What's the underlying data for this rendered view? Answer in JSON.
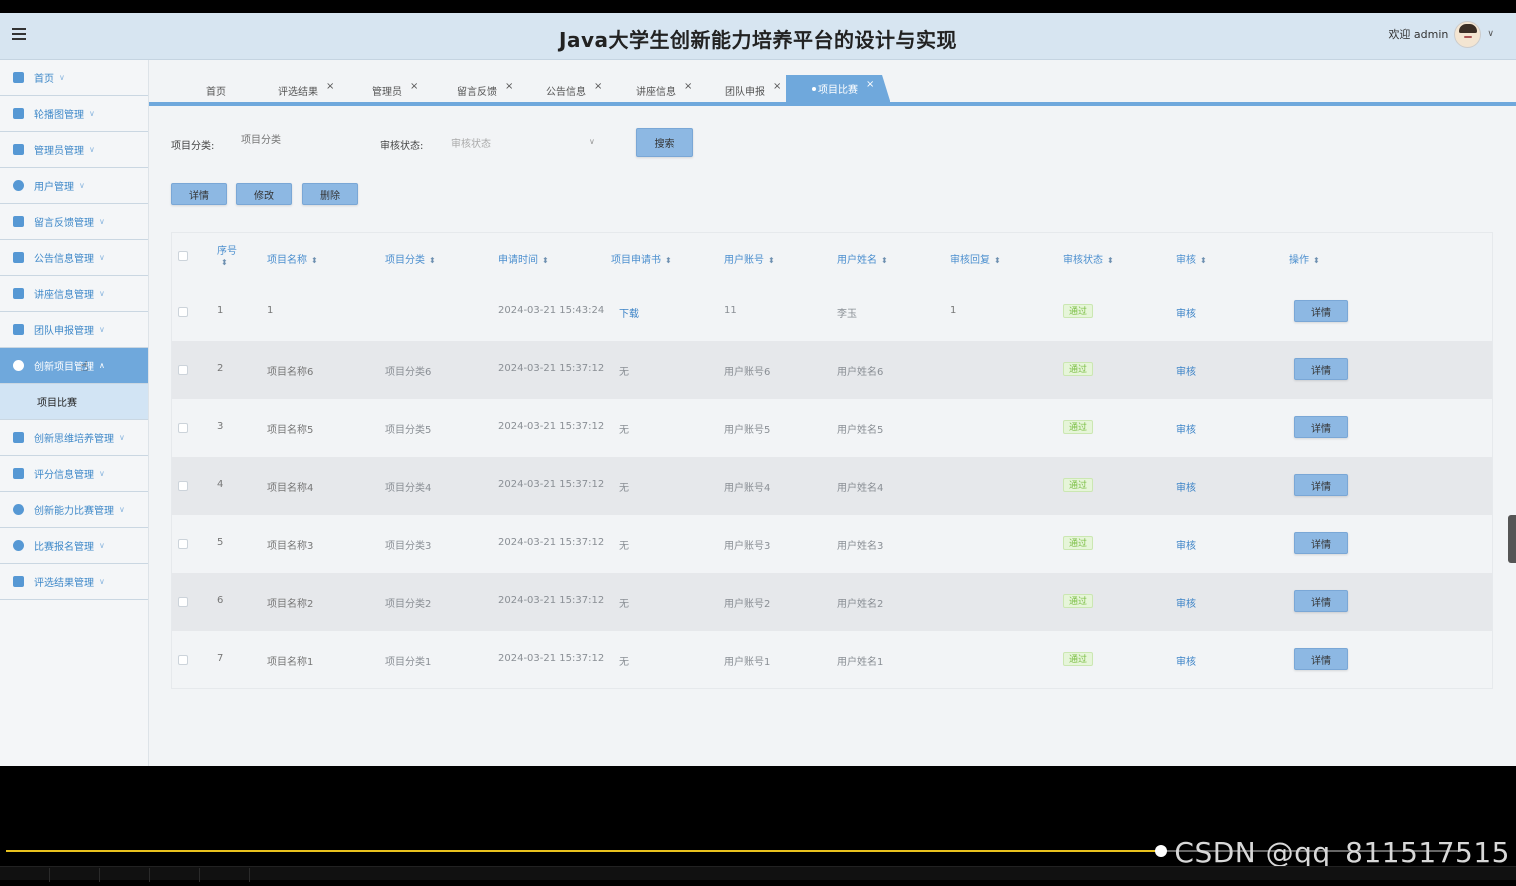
{
  "header": {
    "title": "Java大学生创新能力培养平台的设计与实现",
    "welcome": "欢迎 admin"
  },
  "sidebar": {
    "items": [
      {
        "label": "首页"
      },
      {
        "label": "轮播图管理"
      },
      {
        "label": "管理员管理"
      },
      {
        "label": "用户管理"
      },
      {
        "label": "留言反馈管理"
      },
      {
        "label": "公告信息管理"
      },
      {
        "label": "讲座信息管理"
      },
      {
        "label": "团队申报管理"
      },
      {
        "label": "创新项目管理"
      },
      {
        "label": "创新思维培养管理"
      },
      {
        "label": "评分信息管理"
      },
      {
        "label": "创新能力比赛管理"
      },
      {
        "label": "比赛报名管理"
      },
      {
        "label": "评选结果管理"
      }
    ],
    "sub_item": "项目比赛"
  },
  "tabs": [
    {
      "label": "首页"
    },
    {
      "label": "评选结果"
    },
    {
      "label": "管理员"
    },
    {
      "label": "留言反馈"
    },
    {
      "label": "公告信息"
    },
    {
      "label": "讲座信息"
    },
    {
      "label": "团队申报"
    },
    {
      "label": "项目比赛"
    }
  ],
  "search": {
    "category_label": "项目分类:",
    "category_placeholder": "项目分类",
    "status_label": "审核状态:",
    "status_placeholder": "审核状态",
    "search_button": "搜索"
  },
  "toolbar": {
    "detail": "详情",
    "edit": "修改",
    "delete": "删除"
  },
  "table": {
    "headers": [
      "序号",
      "项目名称",
      "项目分类",
      "申请时间",
      "项目申请书",
      "用户账号",
      "用户姓名",
      "审核回复",
      "审核状态",
      "审核",
      "操作"
    ],
    "rows": [
      {
        "no": "1",
        "name": "1",
        "category": "",
        "time": "2024-03-21 15:43:24",
        "doc": "下载",
        "account": "11",
        "username": "李玉",
        "reply": "1",
        "status": "通过",
        "review": "审核",
        "action": "详情"
      },
      {
        "no": "2",
        "name": "项目名称6",
        "category": "项目分类6",
        "time": "2024-03-21 15:37:12",
        "doc": "无",
        "account": "用户账号6",
        "username": "用户姓名6",
        "reply": "",
        "status": "通过",
        "review": "审核",
        "action": "详情"
      },
      {
        "no": "3",
        "name": "项目名称5",
        "category": "项目分类5",
        "time": "2024-03-21 15:37:12",
        "doc": "无",
        "account": "用户账号5",
        "username": "用户姓名5",
        "reply": "",
        "status": "通过",
        "review": "审核",
        "action": "详情"
      },
      {
        "no": "4",
        "name": "项目名称4",
        "category": "项目分类4",
        "time": "2024-03-21 15:37:12",
        "doc": "无",
        "account": "用户账号4",
        "username": "用户姓名4",
        "reply": "",
        "status": "通过",
        "review": "审核",
        "action": "详情"
      },
      {
        "no": "5",
        "name": "项目名称3",
        "category": "项目分类3",
        "time": "2024-03-21 15:37:12",
        "doc": "无",
        "account": "用户账号3",
        "username": "用户姓名3",
        "reply": "",
        "status": "通过",
        "review": "审核",
        "action": "详情"
      },
      {
        "no": "6",
        "name": "项目名称2",
        "category": "项目分类2",
        "time": "2024-03-21 15:37:12",
        "doc": "无",
        "account": "用户账号2",
        "username": "用户姓名2",
        "reply": "",
        "status": "通过",
        "review": "审核",
        "action": "详情"
      },
      {
        "no": "7",
        "name": "项目名称1",
        "category": "项目分类1",
        "time": "2024-03-21 15:37:12",
        "doc": "无",
        "account": "用户账号1",
        "username": "用户姓名1",
        "reply": "",
        "status": "通过",
        "review": "审核",
        "action": "详情"
      }
    ]
  },
  "watermark": "CSDN @qq_811517515",
  "colors": {
    "accent": "#6fa8dc",
    "header_bg": "#d7e5f1",
    "status_pass": "#7bbf44",
    "progress": "#e8c21e"
  }
}
